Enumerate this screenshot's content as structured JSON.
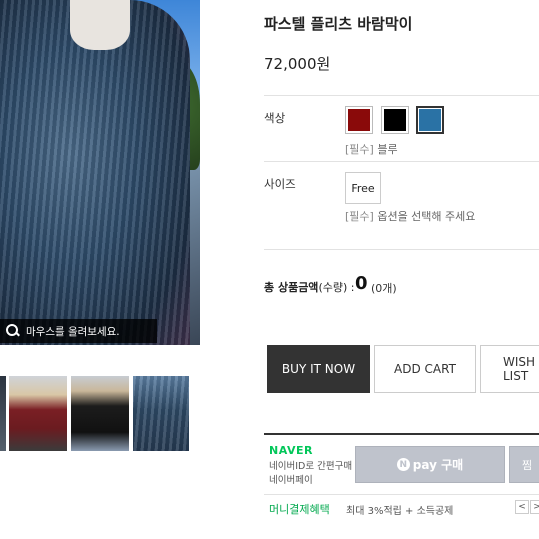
{
  "gallery": {
    "zoom_hint": "마우스를 올려보세요."
  },
  "product": {
    "title": "파스텔 플리츠 바람막이",
    "price": "72,000원"
  },
  "options": {
    "color": {
      "label": "색상",
      "swatches": [
        {
          "name": "red",
          "color": "#8a0a0a"
        },
        {
          "name": "black",
          "color": "#000000"
        },
        {
          "name": "blue",
          "color": "#2a72a5"
        }
      ],
      "required_tag": "[필수]",
      "selected_text": "블루"
    },
    "size": {
      "label": "사이즈",
      "value": "Free",
      "required_tag": "[필수]",
      "hint": "옵션을 선택해 주세요"
    }
  },
  "total": {
    "label_bold": "총 상품금액",
    "label_normal": "(수량) :",
    "amount": "0",
    "count": "(0개)"
  },
  "actions": {
    "buy_now": "BUY IT NOW",
    "add_cart": "ADD CART",
    "wish": "WISH LIST"
  },
  "naverpay": {
    "brand": "NAVER",
    "line1": "네이버ID로 간편구매",
    "line2": "네이버페이",
    "pay_n": "N",
    "pay_label": "pay 구매",
    "zzim_label": "찜"
  },
  "benefit": {
    "label": "머니결제혜택",
    "text": "최대 3%적립 + 소득공제",
    "prev": "<",
    "next": ">"
  }
}
